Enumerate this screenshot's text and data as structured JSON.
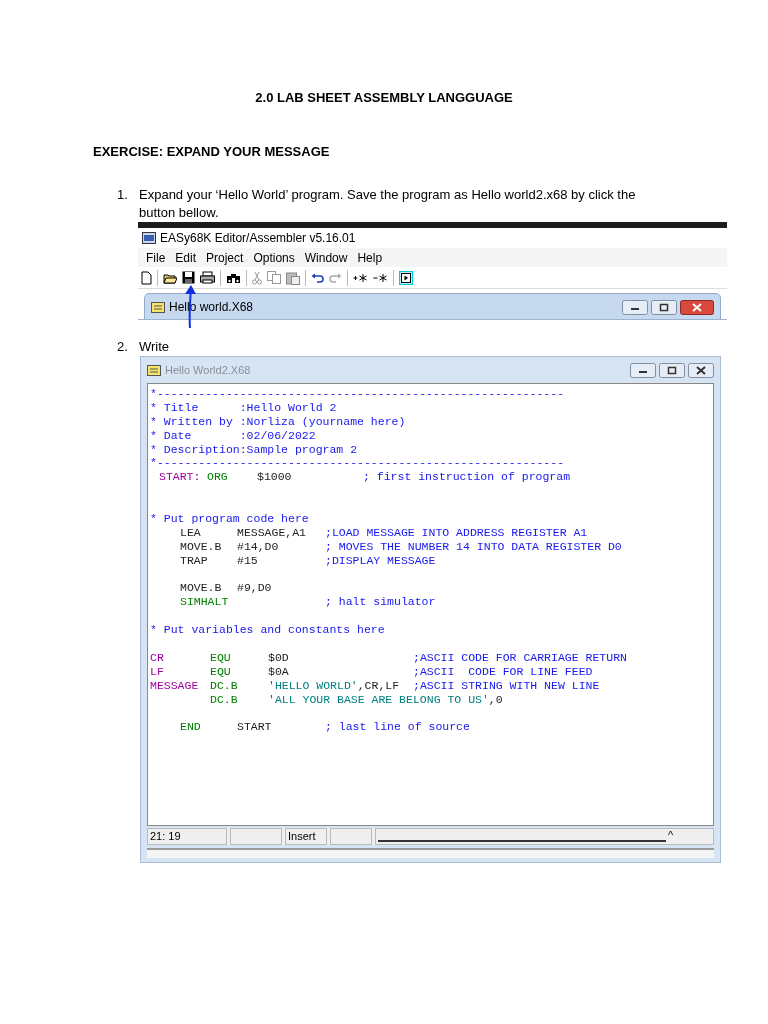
{
  "page_title": "2.0 LAB SHEET ASSEMBLY LANGGUAGE",
  "exercise_heading": "EXERCISE: EXPAND YOUR MESSAGE",
  "steps": [
    {
      "number": "1.",
      "text": "Expand your ‘Hello World’ program. Save the program as Hello world2.x68 by click the button bellow."
    },
    {
      "number": "2.",
      "text": "Write"
    }
  ],
  "editor_window": {
    "title": "EASy68K Editor/Assembler v5.16.01",
    "menu": [
      "File",
      "Edit",
      "Project",
      "Options",
      "Window",
      "Help"
    ],
    "document_title": "Hello world.X68"
  },
  "code_window": {
    "title": "Hello World2.X68",
    "lines": [
      {
        "kind": "comment",
        "text": "*-----------------------------------------------------------"
      },
      {
        "kind": "comment",
        "text": "* Title      :Hello World 2"
      },
      {
        "kind": "comment",
        "text": "* Written by :Norliza (yourname here)"
      },
      {
        "kind": "comment",
        "text": "* Date       :02/06/2022"
      },
      {
        "kind": "comment",
        "text": "* Description:Sample program 2"
      },
      {
        "kind": "comment",
        "text": "*-----------------------------------------------------------"
      },
      {
        "kind": "header",
        "label": "START:",
        "opcode": "ORG",
        "is_directive": true,
        "operand": [
          {
            "text": "$1000",
            "kind": "plain"
          }
        ],
        "comment": "; first instruction of program"
      },
      {
        "kind": "blank"
      },
      {
        "kind": "blank"
      },
      {
        "kind": "comment",
        "text": "* Put program code here"
      },
      {
        "kind": "code",
        "opcode": "LEA",
        "is_directive": false,
        "operand": [
          {
            "text": "MESSAGE,A1",
            "kind": "plain"
          }
        ],
        "comment": ";LOAD MESSAGE INTO ADDRESS REGISTER A1"
      },
      {
        "kind": "code",
        "opcode": "MOVE.B",
        "is_directive": false,
        "operand": [
          {
            "text": "#14,D0",
            "kind": "plain"
          }
        ],
        "comment": "; MOVES THE NUMBER 14 INTO DATA REGISTER D0"
      },
      {
        "kind": "code",
        "opcode": "TRAP",
        "is_directive": false,
        "operand": [
          {
            "text": "#15",
            "kind": "plain"
          }
        ],
        "comment": ";DISPLAY MESSAGE"
      },
      {
        "kind": "blank"
      },
      {
        "kind": "code",
        "opcode": "MOVE.B",
        "is_directive": false,
        "operand": [
          {
            "text": "#9,D0",
            "kind": "plain"
          }
        ]
      },
      {
        "kind": "code",
        "opcode": "SIMHALT",
        "is_directive": true,
        "comment": "; halt simulator"
      },
      {
        "kind": "blank"
      },
      {
        "kind": "comment",
        "text": "* Put variables and constants here"
      },
      {
        "kind": "blank"
      },
      {
        "kind": "data",
        "label": "CR",
        "opcode": "EQU",
        "is_directive": true,
        "operand": [
          {
            "text": "$0D",
            "kind": "plain"
          }
        ],
        "comment": ";ASCII CODE FOR CARRIAGE RETURN"
      },
      {
        "kind": "data",
        "label": "LF",
        "opcode": "EQU",
        "is_directive": true,
        "operand": [
          {
            "text": "$0A",
            "kind": "plain"
          }
        ],
        "comment": ";ASCII  CODE FOR LINE FEED"
      },
      {
        "kind": "data",
        "label": "MESSAGE",
        "opcode": "DC.B",
        "is_directive": true,
        "operand": [
          {
            "text": "'HELLO WORLD'",
            "kind": "string"
          },
          {
            "text": ",CR,LF",
            "kind": "plain"
          }
        ],
        "comment": ";ASCII STRING WITH NEW LINE"
      },
      {
        "kind": "data",
        "opcode": "DC.B",
        "is_directive": true,
        "operand": [
          {
            "text": "'ALL YOUR BASE ARE BELONG TO US'",
            "kind": "string"
          },
          {
            "text": ",0",
            "kind": "plain"
          }
        ]
      },
      {
        "kind": "blank"
      },
      {
        "kind": "code",
        "opcode": "END",
        "is_directive": true,
        "operand": [
          {
            "text": "START",
            "kind": "plain"
          }
        ],
        "comment": "; last line of source"
      }
    ],
    "status_bar": {
      "position": "21: 19",
      "mode": "Insert",
      "caret": "^"
    }
  }
}
